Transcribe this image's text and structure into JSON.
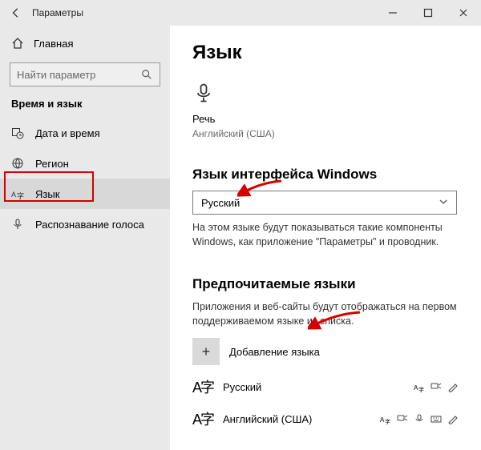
{
  "window": {
    "title": "Параметры"
  },
  "sidebar": {
    "home": "Главная",
    "search_placeholder": "Найти параметр",
    "category": "Время и язык",
    "items": [
      {
        "label": "Дата и время"
      },
      {
        "label": "Регион"
      },
      {
        "label": "Язык"
      },
      {
        "label": "Распознавание голоса"
      }
    ]
  },
  "main": {
    "heading": "Язык",
    "speech": {
      "label": "Речь",
      "sub": "Английский (США)"
    },
    "section_interface": {
      "title": "Язык интерфейса Windows",
      "selected": "Русский",
      "desc": "На этом языке будут показываться такие компоненты Windows, как приложение \"Параметры\" и проводник."
    },
    "section_preferred": {
      "title": "Предпочитаемые языки",
      "desc": "Приложения и веб-сайты будут отображаться на первом поддерживаемом языке из списка.",
      "add_label": "Добавление языка",
      "languages": [
        {
          "glyph": "A字",
          "name": "Русский"
        },
        {
          "glyph": "A字",
          "name": "Английский (США)"
        }
      ]
    }
  }
}
